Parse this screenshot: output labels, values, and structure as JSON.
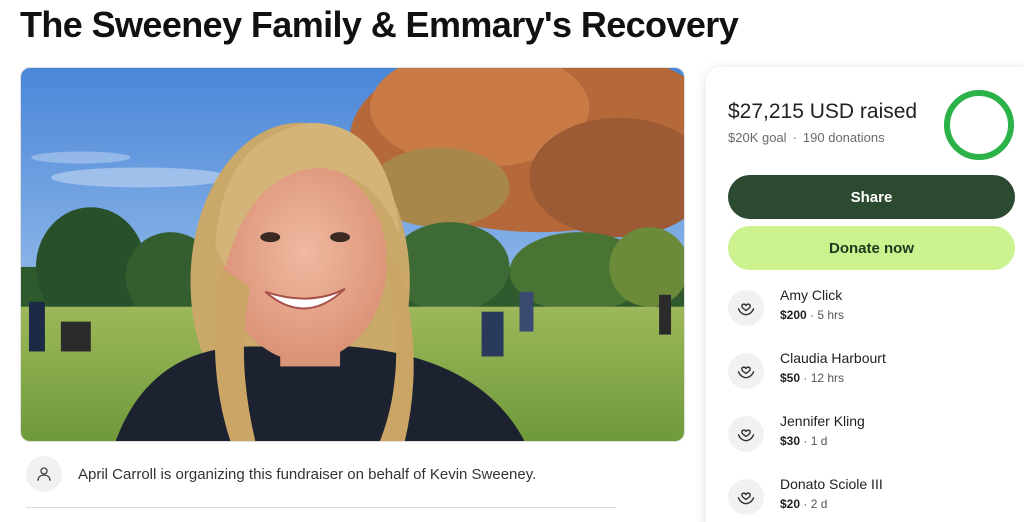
{
  "page": {
    "title": "The Sweeney Family & Emmary's Recovery"
  },
  "hero": {
    "image_description": "photo-smiling-girl-in-park",
    "icon": "photo"
  },
  "organizer": {
    "icon": "person-icon",
    "text": "April Carroll is organizing this fundraiser on behalf of Kevin Sweeney."
  },
  "donation_panel": {
    "raised": "$27,215 USD raised",
    "goal": "$20K goal",
    "separator": "·",
    "donations": "190 donations",
    "progress_fraction": 1.0,
    "progress_color": "#2bb34a",
    "share_label": "Share",
    "donate_label": "Donate now",
    "share_color": "#2b4a2f",
    "donate_color": "#cbf28e",
    "donors": [
      {
        "name": "Amy Click",
        "amount": "$200",
        "time": "5 hrs"
      },
      {
        "name": "Claudia Harbourt",
        "amount": "$50",
        "time": "12 hrs"
      },
      {
        "name": "Jennifer Kling",
        "amount": "$30",
        "time": "1 d"
      },
      {
        "name": "Donato Sciole III",
        "amount": "$20",
        "time": "2 d"
      }
    ]
  }
}
